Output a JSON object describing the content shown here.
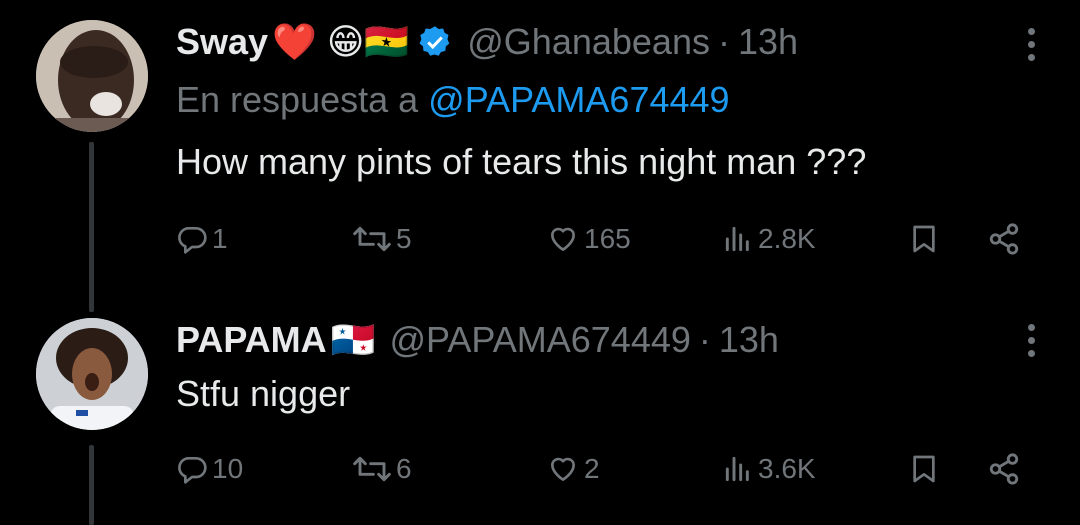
{
  "tweets": [
    {
      "author_name": "Sway",
      "emoji": "❤️ 😁🇬🇭",
      "verified": true,
      "handle": "@Ghanabeans",
      "dot": "·",
      "time": "13h",
      "reply_prefix": "En respuesta a",
      "reply_handle": "@PAPAMA674449",
      "text": "How many pints of tears this night man ???",
      "replies": "1",
      "retweets": "5",
      "likes": "165",
      "views": "2.8K"
    },
    {
      "author_name": "PAPAMA",
      "emoji": "🇵🇦",
      "verified": false,
      "handle": "@PAPAMA674449",
      "dot": "·",
      "time": "13h",
      "text": "Stfu nigger",
      "replies": "10",
      "retweets": "6",
      "likes": "2",
      "views": "3.6K"
    }
  ],
  "icons": {
    "verified_badge": "verified-badge-icon",
    "reply": "reply-icon",
    "retweet": "retweet-icon",
    "like": "heart-icon",
    "views": "views-icon",
    "bookmark": "bookmark-icon",
    "share": "share-icon",
    "more": "more-icon"
  },
  "colors": {
    "background": "#000000",
    "text": "#e7e9ea",
    "muted": "#71767b",
    "link": "#1d9bf0"
  }
}
